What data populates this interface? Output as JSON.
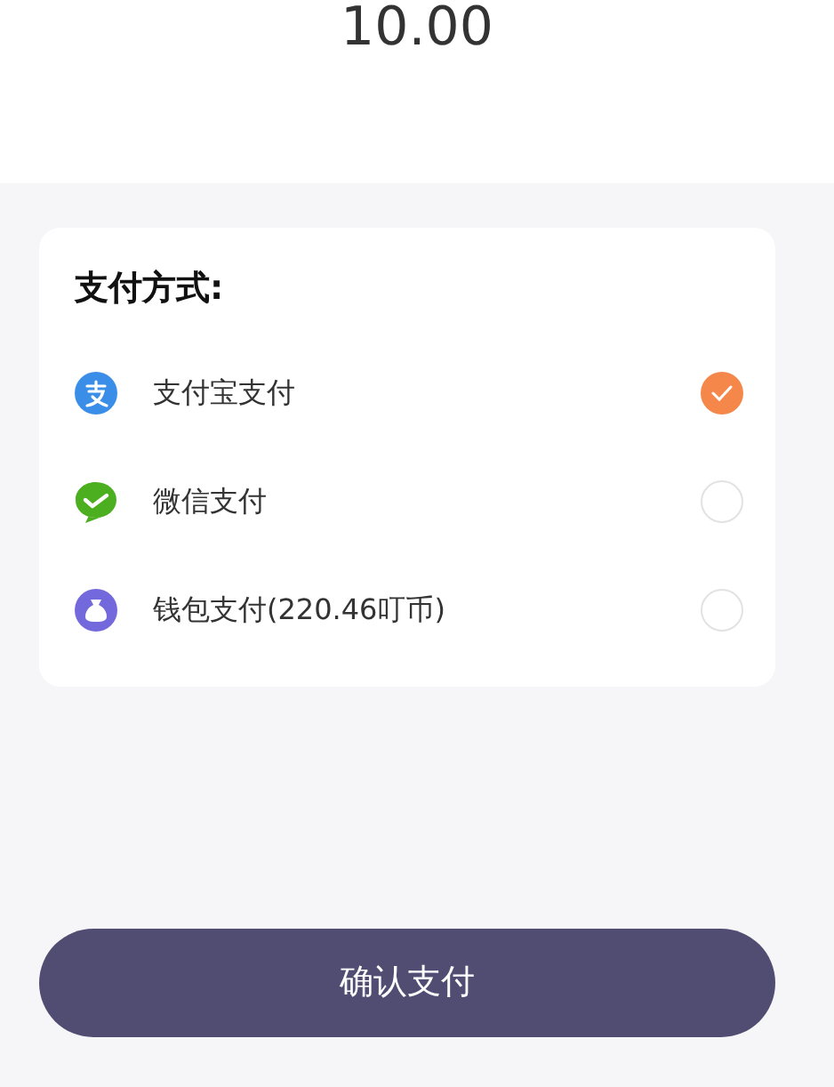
{
  "amount": "10.00",
  "payment": {
    "title": "支付方式:",
    "methods": [
      {
        "kind": "alipay",
        "label": "支付宝支付",
        "selected": true
      },
      {
        "kind": "wechat",
        "label": "微信支付",
        "selected": false
      },
      {
        "kind": "wallet",
        "label": "钱包支付(220.46叮币)",
        "selected": false
      }
    ]
  },
  "confirm_button": "确认支付"
}
